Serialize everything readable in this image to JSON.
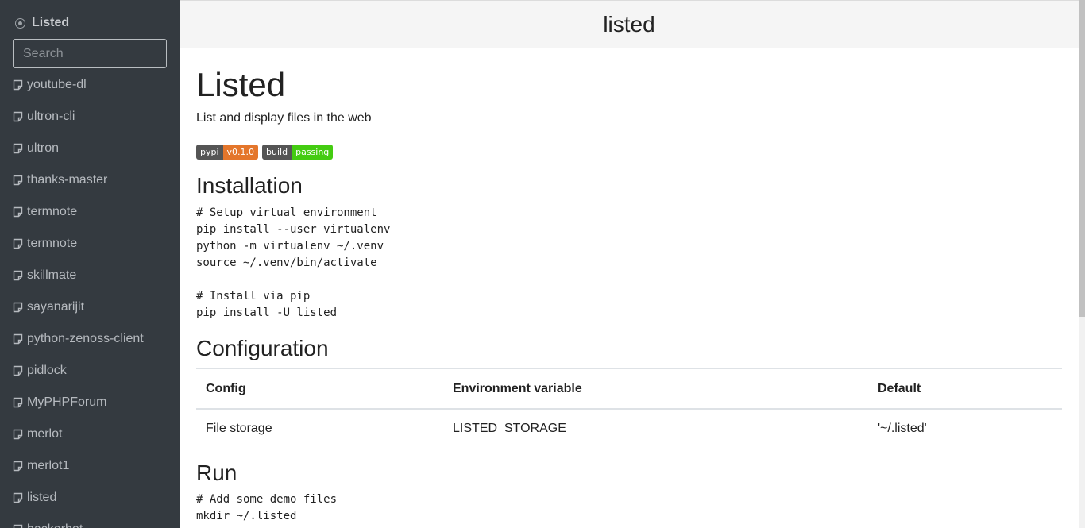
{
  "sidebar": {
    "brand": "Listed",
    "search_placeholder": "Search",
    "items": [
      {
        "label": "youtube-dl"
      },
      {
        "label": "ultron-cli"
      },
      {
        "label": "ultron"
      },
      {
        "label": "thanks-master"
      },
      {
        "label": "termnote"
      },
      {
        "label": "termnote"
      },
      {
        "label": "skillmate"
      },
      {
        "label": "sayanarijit"
      },
      {
        "label": "python-zenoss-client"
      },
      {
        "label": "pidlock"
      },
      {
        "label": "MyPHPForum"
      },
      {
        "label": "merlot"
      },
      {
        "label": "merlot1"
      },
      {
        "label": "listed"
      },
      {
        "label": "hackerbot"
      }
    ]
  },
  "header": {
    "title": "listed"
  },
  "doc": {
    "title": "Listed",
    "subtitle": "List and display files in the web",
    "badges": [
      {
        "left": "pypi",
        "right": "v0.1.0",
        "color": "#e4762b"
      },
      {
        "left": "build",
        "right": "passing",
        "color": "#4c1"
      }
    ],
    "installation": {
      "heading": "Installation",
      "code": "# Setup virtual environment\npip install --user virtualenv\npython -m virtualenv ~/.venv\nsource ~/.venv/bin/activate\n\n# Install via pip\npip install -U listed"
    },
    "configuration": {
      "heading": "Configuration",
      "headers": [
        "Config",
        "Environment variable",
        "Default"
      ],
      "rows": [
        [
          "File storage",
          "LISTED_STORAGE",
          "'~/.listed'"
        ]
      ]
    },
    "run": {
      "heading": "Run",
      "code": "# Add some demo files\nmkdir ~/.listed"
    }
  },
  "colors": {
    "sidebar_bg": "#343a40",
    "topbar_bg": "#f5f5f5"
  }
}
